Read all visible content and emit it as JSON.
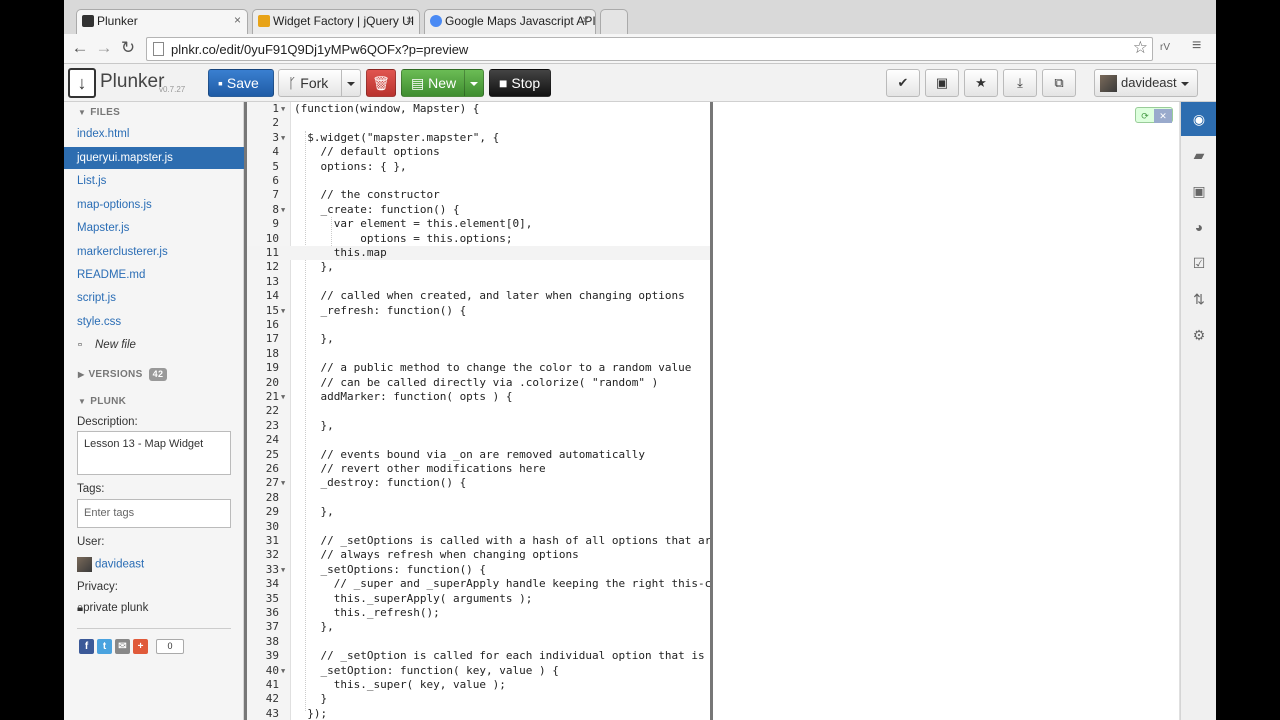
{
  "browser": {
    "tabs": [
      {
        "title": "Plunker",
        "close": "×",
        "icon_color": "#333333",
        "active": true
      },
      {
        "title": "Widget Factory | jQuery UI",
        "close": "×",
        "icon_color": "#e8a317",
        "active": false
      },
      {
        "title": "Google Maps Javascript API",
        "close": "×",
        "icon_color": "#4a8af4",
        "active": false
      }
    ],
    "url": "plnkr.co/edit/0yuF91Q9Dj1yMPw6QOFx?p=preview",
    "toolbar_ext_label": "rV"
  },
  "header": {
    "logo_text": "Plunker",
    "version": "v0.7.27",
    "save_label": "Save",
    "fork_label": "Fork",
    "new_label": "New",
    "stop_label": "Stop",
    "user_label": "davideast",
    "icons": [
      "check-icon",
      "briefcase-icon",
      "star-icon",
      "download-icon",
      "external-link-icon"
    ]
  },
  "sidebar": {
    "files_header": "FILES",
    "files": [
      {
        "name": "index.html",
        "active": false
      },
      {
        "name": "jqueryui.mapster.js",
        "active": true
      },
      {
        "name": "List.js",
        "active": false
      },
      {
        "name": "map-options.js",
        "active": false
      },
      {
        "name": "Mapster.js",
        "active": false
      },
      {
        "name": "markerclusterer.js",
        "active": false
      },
      {
        "name": "README.md",
        "active": false
      },
      {
        "name": "script.js",
        "active": false
      },
      {
        "name": "style.css",
        "active": false
      }
    ],
    "new_file_label": "New file",
    "versions_header": "VERSIONS",
    "versions_count": "42",
    "plunk_header": "PLUNK",
    "description_label": "Description:",
    "description_value": "Lesson 13 - Map Widget",
    "tags_label": "Tags:",
    "tags_placeholder": "Enter tags",
    "user_label": "User:",
    "user_name": "davideast",
    "privacy_label": "Privacy:",
    "privacy_value": "private plunk",
    "share_count": "0"
  },
  "editor": {
    "current_line": 11,
    "lines": [
      {
        "n": "1",
        "fold": true,
        "text": "(function(window, Mapster) {"
      },
      {
        "n": "2",
        "fold": false,
        "text": ""
      },
      {
        "n": "3",
        "fold": true,
        "text": "  $.widget(\"mapster.mapster\", {"
      },
      {
        "n": "4",
        "fold": false,
        "text": "    // default options"
      },
      {
        "n": "5",
        "fold": false,
        "text": "    options: { },"
      },
      {
        "n": "6",
        "fold": false,
        "text": ""
      },
      {
        "n": "7",
        "fold": false,
        "text": "    // the constructor"
      },
      {
        "n": "8",
        "fold": true,
        "text": "    _create: function() {"
      },
      {
        "n": "9",
        "fold": false,
        "text": "      var element = this.element[0],"
      },
      {
        "n": "10",
        "fold": false,
        "text": "          options = this.options;"
      },
      {
        "n": "11",
        "fold": false,
        "text": "      this.map"
      },
      {
        "n": "12",
        "fold": false,
        "text": "    },"
      },
      {
        "n": "13",
        "fold": false,
        "text": ""
      },
      {
        "n": "14",
        "fold": false,
        "text": "    // called when created, and later when changing options"
      },
      {
        "n": "15",
        "fold": true,
        "text": "    _refresh: function() {"
      },
      {
        "n": "16",
        "fold": false,
        "text": ""
      },
      {
        "n": "17",
        "fold": false,
        "text": "    },"
      },
      {
        "n": "18",
        "fold": false,
        "text": ""
      },
      {
        "n": "19",
        "fold": false,
        "text": "    // a public method to change the color to a random value"
      },
      {
        "n": "20",
        "fold": false,
        "text": "    // can be called directly via .colorize( \"random\" )"
      },
      {
        "n": "21",
        "fold": true,
        "text": "    addMarker: function( opts ) {"
      },
      {
        "n": "22",
        "fold": false,
        "text": ""
      },
      {
        "n": "23",
        "fold": false,
        "text": "    },"
      },
      {
        "n": "24",
        "fold": false,
        "text": ""
      },
      {
        "n": "25",
        "fold": false,
        "text": "    // events bound via _on are removed automatically"
      },
      {
        "n": "26",
        "fold": false,
        "text": "    // revert other modifications here"
      },
      {
        "n": "27",
        "fold": true,
        "text": "    _destroy: function() {"
      },
      {
        "n": "28",
        "fold": false,
        "text": ""
      },
      {
        "n": "29",
        "fold": false,
        "text": "    },"
      },
      {
        "n": "30",
        "fold": false,
        "text": ""
      },
      {
        "n": "31",
        "fold": false,
        "text": "    // _setOptions is called with a hash of all options that are"
      },
      {
        "n": "32",
        "fold": false,
        "text": "    // always refresh when changing options"
      },
      {
        "n": "33",
        "fold": true,
        "text": "    _setOptions: function() {"
      },
      {
        "n": "34",
        "fold": false,
        "text": "      // _super and _superApply handle keeping the right this-co"
      },
      {
        "n": "35",
        "fold": false,
        "text": "      this._superApply( arguments );"
      },
      {
        "n": "36",
        "fold": false,
        "text": "      this._refresh();"
      },
      {
        "n": "37",
        "fold": false,
        "text": "    },"
      },
      {
        "n": "38",
        "fold": false,
        "text": ""
      },
      {
        "n": "39",
        "fold": false,
        "text": "    // _setOption is called for each individual option that is c"
      },
      {
        "n": "40",
        "fold": true,
        "text": "    _setOption: function( key, value ) {"
      },
      {
        "n": "41",
        "fold": false,
        "text": "      this._super( key, value );"
      },
      {
        "n": "42",
        "fold": false,
        "text": "    }"
      },
      {
        "n": "43",
        "fold": false,
        "text": "  });"
      }
    ]
  },
  "rail": {
    "icons": [
      "eye-icon",
      "book-icon",
      "briefcase-icon",
      "palette-icon",
      "checkbox-icon",
      "retweet-icon",
      "gear-icon"
    ],
    "active_index": 0
  },
  "colors": {
    "accent_blue": "#2d6db0",
    "save_btn": "#1f5ca6",
    "new_btn": "#3f8d30",
    "delete_btn": "#b9332e",
    "link": "#2a6db5"
  }
}
